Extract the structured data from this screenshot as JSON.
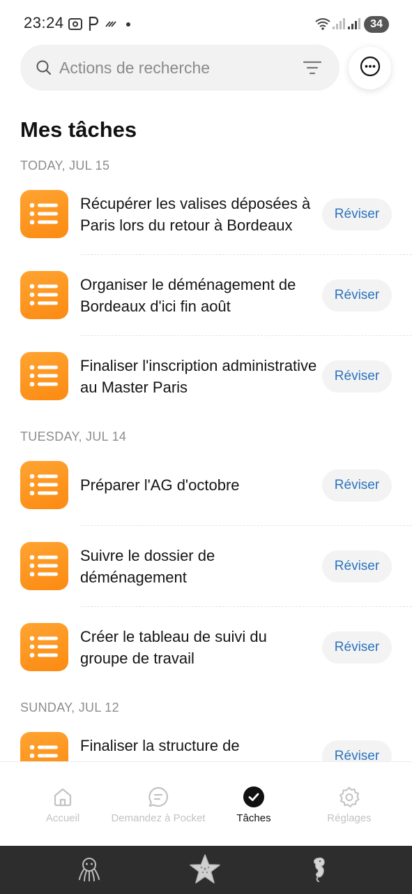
{
  "status_bar": {
    "time": "23:24",
    "battery": "34",
    "icons": [
      "screenshot-icon",
      "p-app-icon",
      "nfc-icon",
      "dot-icon",
      "wifi-icon",
      "signal-icon",
      "signal-roaming-icon",
      "battery-icon"
    ]
  },
  "search": {
    "placeholder": "Actions de recherche",
    "value": ""
  },
  "page_title": "Mes tâches",
  "sections": [
    {
      "label": "TODAY, JUL 15",
      "tasks": [
        {
          "title": "Récupérer les valises déposées à Paris lors du retour à Bordeaux",
          "action": "Réviser"
        },
        {
          "title": "Organiser le déménagement de Bordeaux d'ici fin août",
          "action": "Réviser"
        },
        {
          "title": "Finaliser l'inscription administrative au Master Paris",
          "action": "Réviser"
        }
      ]
    },
    {
      "label": "TUESDAY, JUL 14",
      "tasks": [
        {
          "title": "Préparer l'AG d'octobre",
          "action": "Réviser"
        },
        {
          "title": "Suivre le dossier de déménagement",
          "action": "Réviser"
        },
        {
          "title": "Créer le tableau de suivi du groupe de travail",
          "action": "Réviser"
        }
      ]
    },
    {
      "label": "SUNDAY, JUL 12",
      "tasks": [
        {
          "title": "Finaliser la structure de",
          "action": "Réviser"
        }
      ]
    }
  ],
  "bottom_nav": {
    "items": [
      {
        "label": "Accueil",
        "icon": "home-icon",
        "active": false
      },
      {
        "label": "Demandez à Pocket",
        "icon": "chat-icon",
        "active": false
      },
      {
        "label": "Tâches",
        "icon": "check-circle-icon",
        "active": true
      },
      {
        "label": "Réglages",
        "icon": "gear-icon",
        "active": false
      }
    ]
  },
  "system_bar": {
    "icons": [
      "octopus-icon",
      "starfish-icon",
      "seahorse-icon"
    ]
  },
  "colors": {
    "accent_orange": "#fb8a12",
    "review_blue": "#2a73bf",
    "system_bar": "#2d2d2d"
  }
}
